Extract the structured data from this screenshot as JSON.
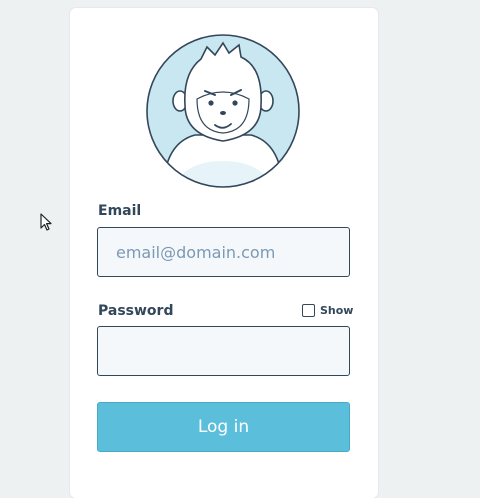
{
  "form": {
    "email_label": "Email",
    "email_placeholder": "email@domain.com",
    "email_value": "",
    "password_label": "Password",
    "password_value": "",
    "show_label": "Show",
    "show_checked": false,
    "login_label": "Log in"
  },
  "avatar": {
    "icon": "yeti-mascot-avatar",
    "colors": {
      "background": "#c9e7f1",
      "outline": "#33475b",
      "fur": "#ffffff"
    }
  },
  "theme": {
    "accent": "#5bbfdc",
    "text": "#33475b",
    "input_background": "#f5f8fa",
    "page_background": "#eef1f1"
  }
}
